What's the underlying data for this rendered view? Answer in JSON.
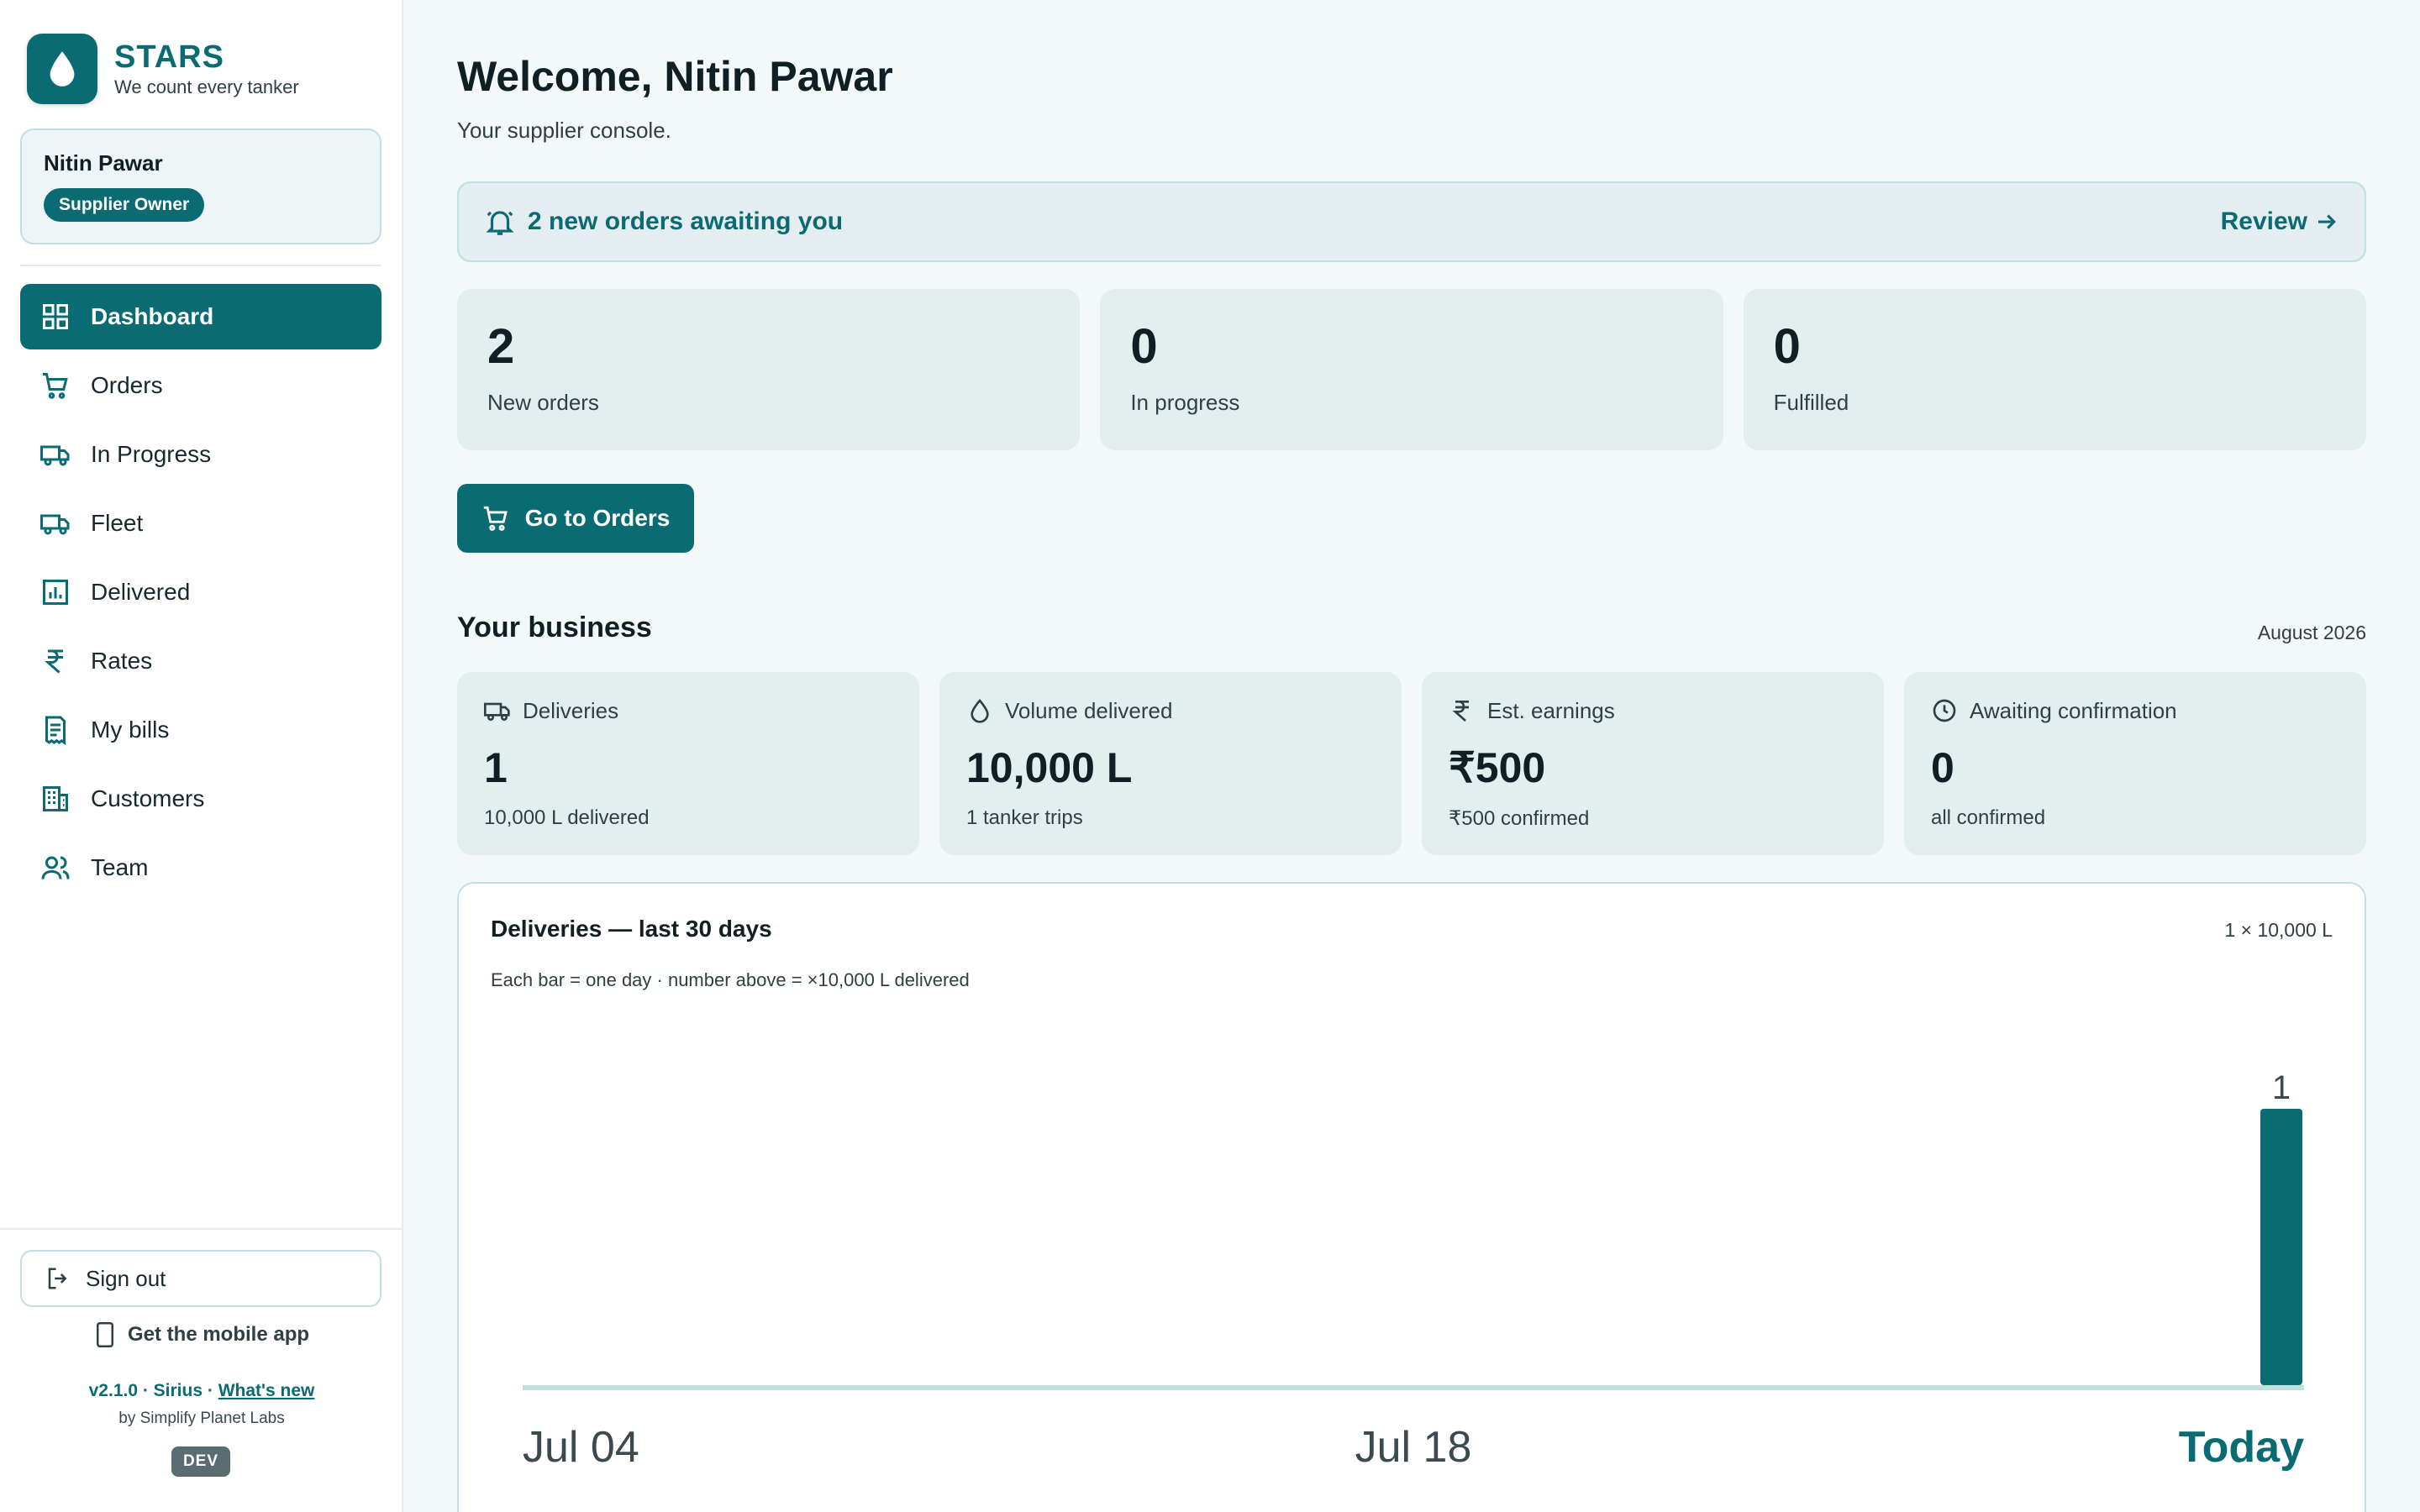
{
  "brand": {
    "name": "STARS",
    "tagline": "We count every tanker"
  },
  "user": {
    "name": "Nitin Pawar",
    "role": "Supplier Owner"
  },
  "nav": [
    {
      "label": "Dashboard",
      "icon": "grid-icon",
      "active": true
    },
    {
      "label": "Orders",
      "icon": "cart-icon"
    },
    {
      "label": "In Progress",
      "icon": "truck-icon"
    },
    {
      "label": "Fleet",
      "icon": "truck-icon"
    },
    {
      "label": "Delivered",
      "icon": "bar-chart-icon"
    },
    {
      "label": "Rates",
      "icon": "rupee-icon"
    },
    {
      "label": "My bills",
      "icon": "receipt-icon"
    },
    {
      "label": "Customers",
      "icon": "building-icon"
    },
    {
      "label": "Team",
      "icon": "users-icon"
    }
  ],
  "footer": {
    "sign_out": "Sign out",
    "mobile_app": "Get the mobile app",
    "version": "v2.1.0 · Sirius · ",
    "whats_new": "What's new",
    "byline": "by Simplify Planet Labs",
    "env": "DEV"
  },
  "header": {
    "title": "Welcome, Nitin Pawar",
    "subtitle": "Your supplier console."
  },
  "alert": {
    "text": "2 new orders awaiting you",
    "action": "Review"
  },
  "stats": [
    {
      "value": "2",
      "label": "New orders"
    },
    {
      "value": "0",
      "label": "In progress"
    },
    {
      "value": "0",
      "label": "Fulfilled"
    }
  ],
  "cta": {
    "label": "Go to Orders"
  },
  "business": {
    "title": "Your business",
    "period": "August 2026",
    "cards": [
      {
        "icon": "truck-icon",
        "label": "Deliveries",
        "value": "1",
        "sub": "10,000 L delivered"
      },
      {
        "icon": "droplet-icon",
        "label": "Volume delivered",
        "value": "10,000 L",
        "sub": "1 tanker trips"
      },
      {
        "icon": "rupee-icon",
        "label": "Est. earnings",
        "value": "₹500",
        "sub": "₹500 confirmed"
      },
      {
        "icon": "clock-icon",
        "label": "Awaiting confirmation",
        "value": "0",
        "sub": "all confirmed"
      }
    ]
  },
  "colors": {
    "accent": "#0b6b73",
    "baseline": "#bfe0dc"
  },
  "chart_data": {
    "type": "bar",
    "title": "Deliveries — last 30 days",
    "scale_label": "1 × 10,000 L",
    "note": "Each bar = one day · number above = ×10,000 L delivered",
    "x_tick_labels": [
      "Jul 04",
      "Jul 18",
      "Today"
    ],
    "days": 30,
    "values": [
      0,
      0,
      0,
      0,
      0,
      0,
      0,
      0,
      0,
      0,
      0,
      0,
      0,
      0,
      0,
      0,
      0,
      0,
      0,
      0,
      0,
      0,
      0,
      0,
      0,
      0,
      0,
      0,
      0,
      1
    ],
    "ylim": [
      0,
      1
    ]
  }
}
